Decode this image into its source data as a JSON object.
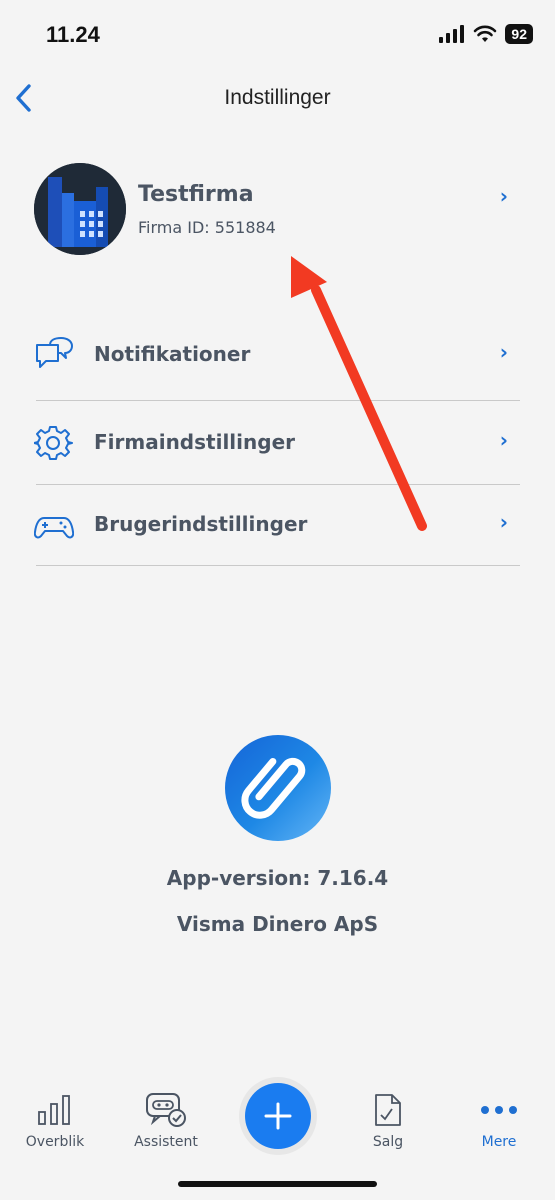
{
  "status_bar": {
    "time": "11.24",
    "battery": "92"
  },
  "nav": {
    "title": "Indstillinger"
  },
  "company": {
    "name": "Testfirma",
    "id_label": "Firma ID: 551884"
  },
  "menu": [
    {
      "label": "Notifikationer",
      "icon": "chat-bubbles-icon"
    },
    {
      "label": "Firmaindstillinger",
      "icon": "gear-icon"
    },
    {
      "label": "Brugerindstillinger",
      "icon": "gamepad-icon"
    }
  ],
  "footer": {
    "app_version": "App-version: 7.16.4",
    "company": "Visma Dinero ApS"
  },
  "tabs": [
    {
      "label": "Overblik",
      "icon": "bar-chart-icon"
    },
    {
      "label": "Assistent",
      "icon": "assistant-icon"
    },
    {
      "label": "Salg",
      "icon": "document-icon"
    },
    {
      "label": "Mere",
      "icon": "more-dots-icon",
      "active": true
    }
  ],
  "colors": {
    "accent": "#1f6fd1",
    "annotation_arrow": "#f23a22",
    "background": "#f4f4f4"
  }
}
